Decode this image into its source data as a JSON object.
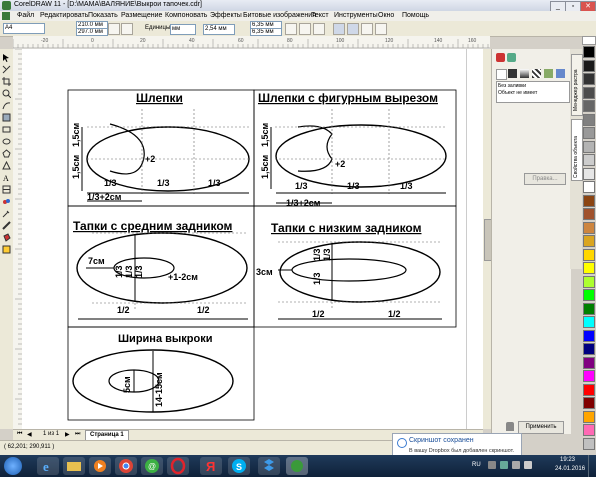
{
  "window": {
    "title": "CorelDRAW 11 - [D:\\МАМА\\ВАЛЯНИЕ\\Выкрои тапочек.cdr]",
    "min": "_",
    "max": "▫",
    "close": "✕"
  },
  "menu": [
    "Файл",
    "Редактировать",
    "Показать",
    "Размещение",
    "Компоновать",
    "Эффекты",
    "Битовые изображения",
    "Текст",
    "Инструменты",
    "Окно",
    "Помощь"
  ],
  "toolbar": {
    "paper": "A4",
    "width": "210.0 мм",
    "height": "297.0 мм",
    "units_label": "Единицы:",
    "units_value": "мм",
    "nudge": "2,54 мм",
    "dup_x": "6,35 мм",
    "dup_y": "6,35 мм"
  },
  "ruler": {
    "top": [
      "-20",
      "0",
      "20",
      "40",
      "60",
      "80",
      "100",
      "120",
      "140",
      "160"
    ],
    "unit": "миллиметры"
  },
  "shapes": {
    "p1": {
      "title": "Шлепки",
      "h_top": "1,5см",
      "h_bottom": "1,5см",
      "plus": "+2",
      "third": "1/3",
      "total": "1/3+2см"
    },
    "p2": {
      "title": "Шлепки с фигурным вырезом",
      "h_top": "1,5см",
      "h_bottom": "1,5см",
      "plus": "+2",
      "third": "1/3",
      "total": "1/3+2см"
    },
    "p3": {
      "title": "Тапки с средним задником",
      "back": "7см",
      "v": "1/3",
      "plus": "+1-2см",
      "half": "1/2"
    },
    "p4": {
      "title": "Тапки с низким задником",
      "back": "3см",
      "v": "1/3",
      "half": "1/2"
    },
    "p5": {
      "title": "Ширина выкроки",
      "inner": "5см",
      "outer": "14-15см"
    }
  },
  "docker": {
    "item1": "Без заливки",
    "item2": "Объект не имеет",
    "edit_btn": "Правка...",
    "apply_btn": "Применить",
    "tab1": "Менеджер растра",
    "tab2": "Свойства объекта"
  },
  "pages": {
    "counter": "1 из 1",
    "tab": "Страница 1"
  },
  "status": {
    "coords": "( 62,201; 290,911 )"
  },
  "notification": {
    "title": "Скриншот сохранен",
    "body": "В вашу Dropbox был добавлен скриншот."
  },
  "taskbar": {
    "lang": "RU",
    "time": "19:23",
    "date": "24.01.2016"
  },
  "palette": [
    "#000000",
    "#1a1a1a",
    "#333333",
    "#4d4d4d",
    "#666666",
    "#808080",
    "#999999",
    "#b3b3b3",
    "#cccccc",
    "#e6e6e6",
    "#ffffff",
    "#8b4513",
    "#a0522d",
    "#cd853f",
    "#daa520",
    "#ffd700",
    "#ffff00",
    "#adff2f",
    "#00ff00",
    "#008000",
    "#00ffff",
    "#0000ff",
    "#000080",
    "#800080",
    "#ff00ff",
    "#ff0000",
    "#800000",
    "#ffa500",
    "#ff69b4",
    "#c0c0c0"
  ]
}
